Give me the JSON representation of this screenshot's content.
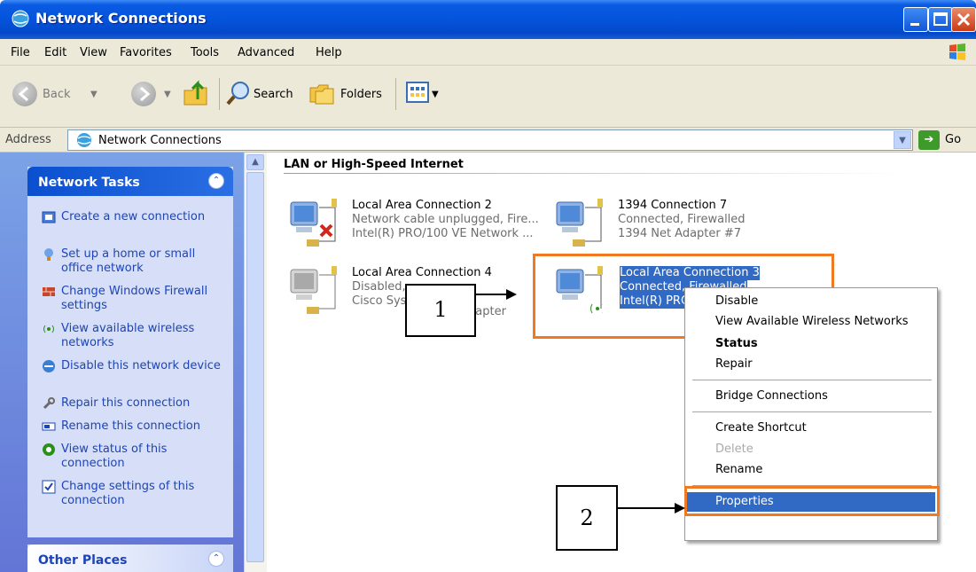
{
  "window": {
    "title": "Network Connections",
    "title_icon": "network-connections-icon"
  },
  "menu": [
    "File",
    "Edit",
    "View",
    "Favorites",
    "Tools",
    "Advanced",
    "Help"
  ],
  "toolbar": {
    "back": "Back",
    "search": "Search",
    "folders": "Folders"
  },
  "address": {
    "label": "Address",
    "value": "Network Connections",
    "go": "Go"
  },
  "sidebar": {
    "network_tasks": {
      "title": "Network Tasks",
      "items": [
        "Create a new connection",
        "Set up a home or small office network",
        "Change Windows Firewall settings",
        "View available wireless networks",
        "Disable this network device",
        "Repair this connection",
        "Rename this connection",
        "View status of this connection",
        "Change settings of this connection"
      ]
    },
    "other_places": {
      "title": "Other Places"
    }
  },
  "content": {
    "group_title": "LAN or High-Speed Internet",
    "connections": [
      {
        "name": "Local Area Connection 2",
        "status": "Network cable unplugged, Fire...",
        "device": "Intel(R) PRO/100 VE Network ..."
      },
      {
        "name": "1394 Connection 7",
        "status": "Connected, Firewalled",
        "device": "1394 Net Adapter #7"
      },
      {
        "name": "Local Area Connection 4",
        "status": "Disabled,",
        "device": "Cisco Sys"
      },
      {
        "name": "Local Area Connection 3",
        "status": "Connected, Firewalled",
        "device": "Intel(R) PRO"
      }
    ],
    "conn4_partial_device": "dapter",
    "conn4_partial_name": "on 4"
  },
  "context_menu": {
    "items": [
      "Disable",
      "View Available Wireless Networks",
      "Status",
      "Repair",
      "Bridge Connections",
      "Create Shortcut",
      "Delete",
      "Rename",
      "Properties"
    ]
  },
  "callouts": {
    "one": "1",
    "two": "2"
  },
  "colors": {
    "selection": "#316ac5",
    "highlight_border": "#f07a22",
    "task_link": "#1d44b8"
  }
}
